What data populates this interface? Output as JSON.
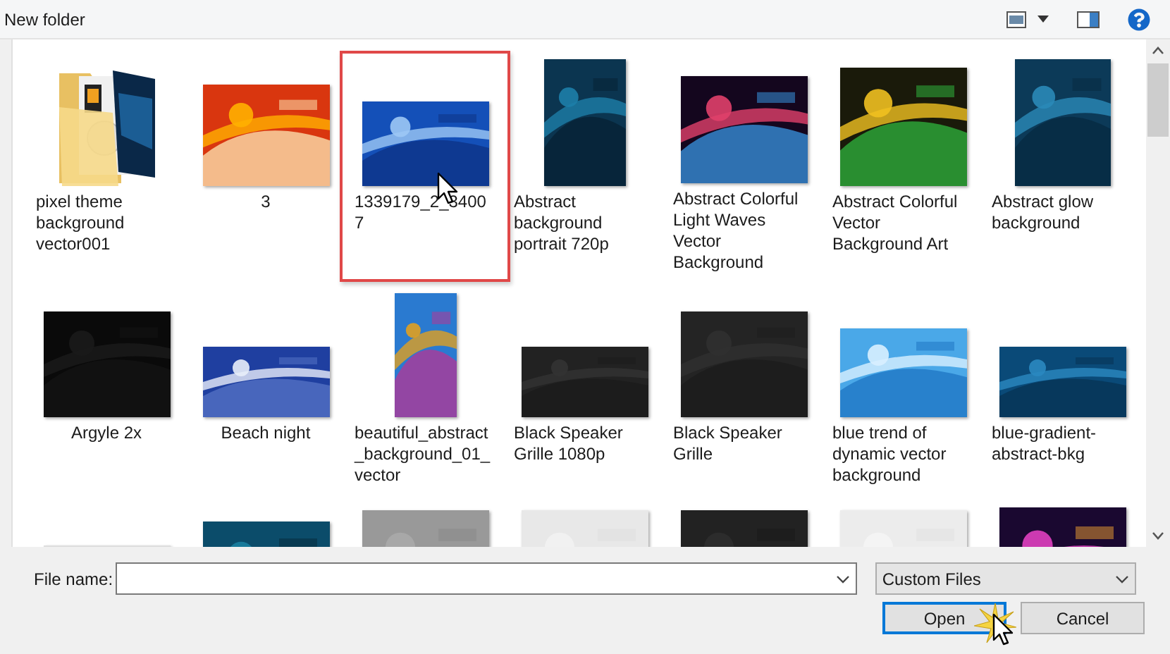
{
  "title": "New folder",
  "tiles": [
    {
      "kind": "folder",
      "label": "pixel theme background vector001",
      "selected": false
    },
    {
      "label": "3",
      "selected": false
    },
    {
      "label": "1339179_2_3400 7",
      "selected": true
    },
    {
      "label": "Abstract background portrait 720p",
      "selected": false
    },
    {
      "label": "Abstract Colorful Light Waves Vector Background",
      "selected": false
    },
    {
      "label": "Abstract Colorful Vector Background Art",
      "selected": false
    },
    {
      "label": "Abstract glow background",
      "selected": false
    },
    {
      "label": "Argyle 2x",
      "selected": false
    },
    {
      "label": "Beach night",
      "selected": false
    },
    {
      "label": "beautiful_abstract_background_01_vector",
      "selected": false
    },
    {
      "label": "Black Speaker Grille 1080p",
      "selected": false
    },
    {
      "label": "Black Speaker Grille",
      "selected": false
    },
    {
      "label": "blue trend of dynamic vector background",
      "selected": false
    },
    {
      "label": "blue-gradient-abstract-bkg",
      "selected": false
    },
    {
      "kind": "picture"
    },
    {
      "kind": "picture"
    },
    {
      "kind": "picture"
    },
    {
      "kind": "picture"
    },
    {
      "kind": "picture"
    },
    {
      "kind": "picture"
    },
    {
      "kind": "picture"
    }
  ],
  "file_name": {
    "label": "File name:"
  },
  "file_type": {
    "value": "Custom Files"
  },
  "buttons": [
    {
      "label": "Open",
      "default": true
    },
    {
      "label": "Cancel",
      "default": false
    }
  ]
}
